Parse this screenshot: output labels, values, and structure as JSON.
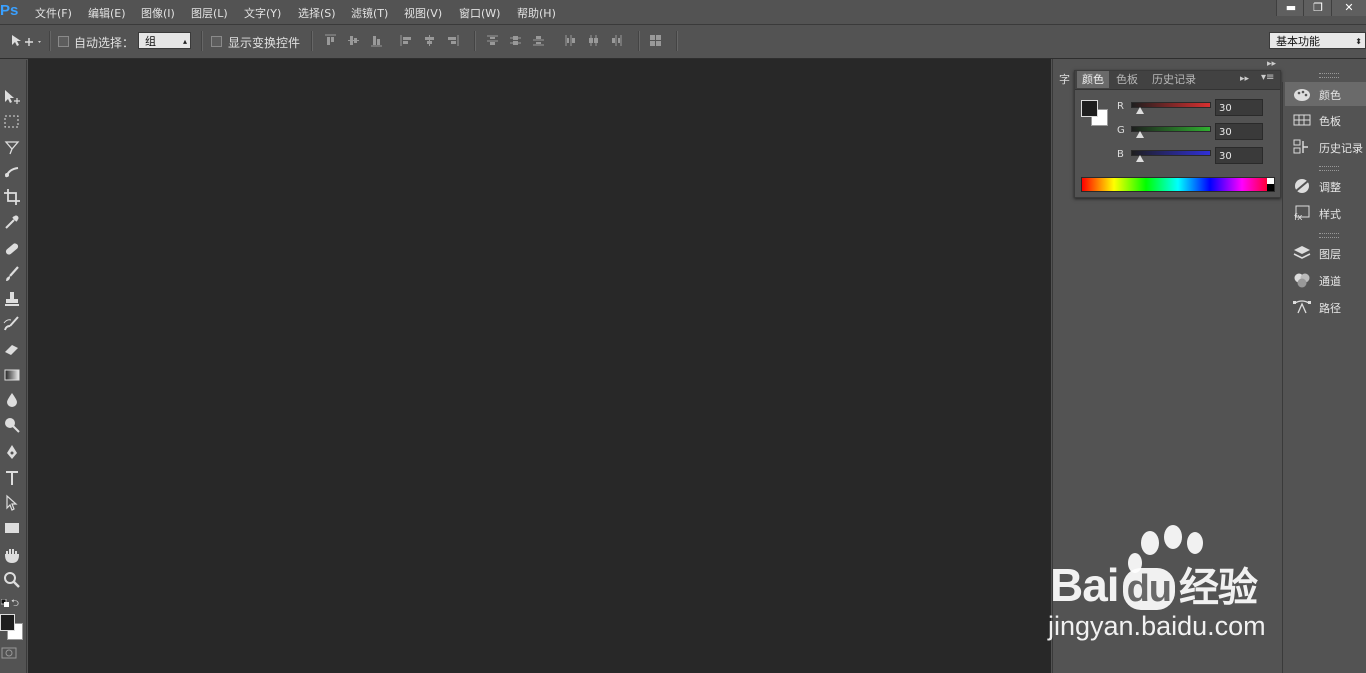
{
  "app": {
    "logo": "Ps"
  },
  "menus": [
    "文件(F)",
    "编辑(E)",
    "图像(I)",
    "图层(L)",
    "文字(Y)",
    "选择(S)",
    "滤镜(T)",
    "视图(V)",
    "窗口(W)",
    "帮助(H)"
  ],
  "window_controls": {
    "minimize": "▬",
    "restore": "❐",
    "close": "✕"
  },
  "options_bar": {
    "auto_select_label": "自动选择：",
    "auto_select_value": "组",
    "show_transform_label": "显示变换控件",
    "workspace": "基本功能"
  },
  "color_panel": {
    "tab_partial": "字",
    "tabs": [
      "颜色",
      "色板",
      "历史记录"
    ],
    "channels": [
      {
        "label": "R",
        "value": "30",
        "color": "#d83030"
      },
      {
        "label": "G",
        "value": "30",
        "color": "#30b030"
      },
      {
        "label": "B",
        "value": "30",
        "color": "#3030d8"
      }
    ],
    "channel_level": 0.118
  },
  "right_dock": {
    "groups": [
      [
        {
          "label": "颜色",
          "icon": "color-palette-icon"
        },
        {
          "label": "色板",
          "icon": "swatches-icon"
        },
        {
          "label": "历史记录",
          "icon": "history-icon"
        }
      ],
      [
        {
          "label": "调整",
          "icon": "adjustments-icon"
        },
        {
          "label": "样式",
          "icon": "styles-icon"
        }
      ],
      [
        {
          "label": "图层",
          "icon": "layers-icon"
        },
        {
          "label": "通道",
          "icon": "channels-icon"
        },
        {
          "label": "路径",
          "icon": "paths-icon"
        }
      ]
    ]
  },
  "watermark": {
    "brand_en": "Bai",
    "brand_du": "du",
    "brand_cn": "经验",
    "url": "jingyan.baidu.com"
  }
}
